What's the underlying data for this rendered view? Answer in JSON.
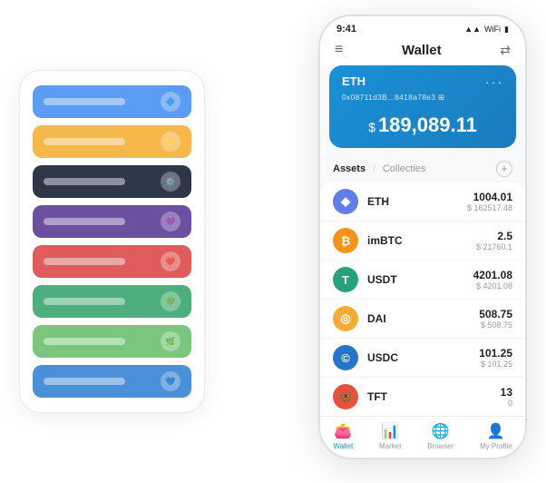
{
  "scene": {
    "card_stack": {
      "cards": [
        {
          "id": "blue-card",
          "color": "#5B9CF6",
          "icon": "🔷"
        },
        {
          "id": "yellow-card",
          "color": "#F6B84B",
          "icon": "⭐"
        },
        {
          "id": "dark-card",
          "color": "#2E3748",
          "icon": "⚙️"
        },
        {
          "id": "purple-card",
          "color": "#6B4FA0",
          "icon": "💜"
        },
        {
          "id": "red-card",
          "color": "#E05C5C",
          "icon": "❤️"
        },
        {
          "id": "green-card",
          "color": "#4CAF7D",
          "icon": "💚"
        },
        {
          "id": "light-green-card",
          "color": "#7BC67E",
          "icon": "🌿"
        },
        {
          "id": "blue2-card",
          "color": "#4A90D9",
          "icon": "💙"
        }
      ]
    },
    "phone": {
      "status_bar": {
        "time": "9:41",
        "icons": "▲▲ ⬛"
      },
      "header": {
        "menu_icon": "≡",
        "title": "Wallet",
        "scan_icon": "⇄"
      },
      "eth_card": {
        "label": "ETH",
        "address": "0x08711d3B...8418a78e3",
        "address_suffix": "⊞",
        "balance_prefix": "$",
        "balance": "189,089.11",
        "more_icon": "···"
      },
      "assets_section": {
        "tab_active": "Assets",
        "tab_separator": "/",
        "tab_inactive": "Collecties",
        "add_icon": "+"
      },
      "assets": [
        {
          "name": "ETH",
          "icon_color": "#627EEA",
          "icon_text": "◆",
          "amount": "1004.01",
          "usd": "$ 162517.48"
        },
        {
          "name": "imBTC",
          "icon_color": "#F7931A",
          "icon_text": "₿",
          "amount": "2.5",
          "usd": "$ 21760.1"
        },
        {
          "name": "USDT",
          "icon_color": "#26A17B",
          "icon_text": "T",
          "amount": "4201.08",
          "usd": "$ 4201.08"
        },
        {
          "name": "DAI",
          "icon_color": "#F5AC37",
          "icon_text": "◎",
          "amount": "508.75",
          "usd": "$ 508.75"
        },
        {
          "name": "USDC",
          "icon_color": "#2775CA",
          "icon_text": "©",
          "amount": "101.25",
          "usd": "$ 101.25"
        },
        {
          "name": "TFT",
          "icon_color": "#E8523A",
          "icon_text": "🦋",
          "amount": "13",
          "usd": "0"
        }
      ],
      "nav": {
        "items": [
          {
            "id": "wallet",
            "icon": "👛",
            "label": "Wallet",
            "active": true
          },
          {
            "id": "market",
            "icon": "📊",
            "label": "Market",
            "active": false
          },
          {
            "id": "browser",
            "icon": "🌐",
            "label": "Browser",
            "active": false
          },
          {
            "id": "profile",
            "icon": "👤",
            "label": "My Profile",
            "active": false
          }
        ]
      }
    }
  }
}
